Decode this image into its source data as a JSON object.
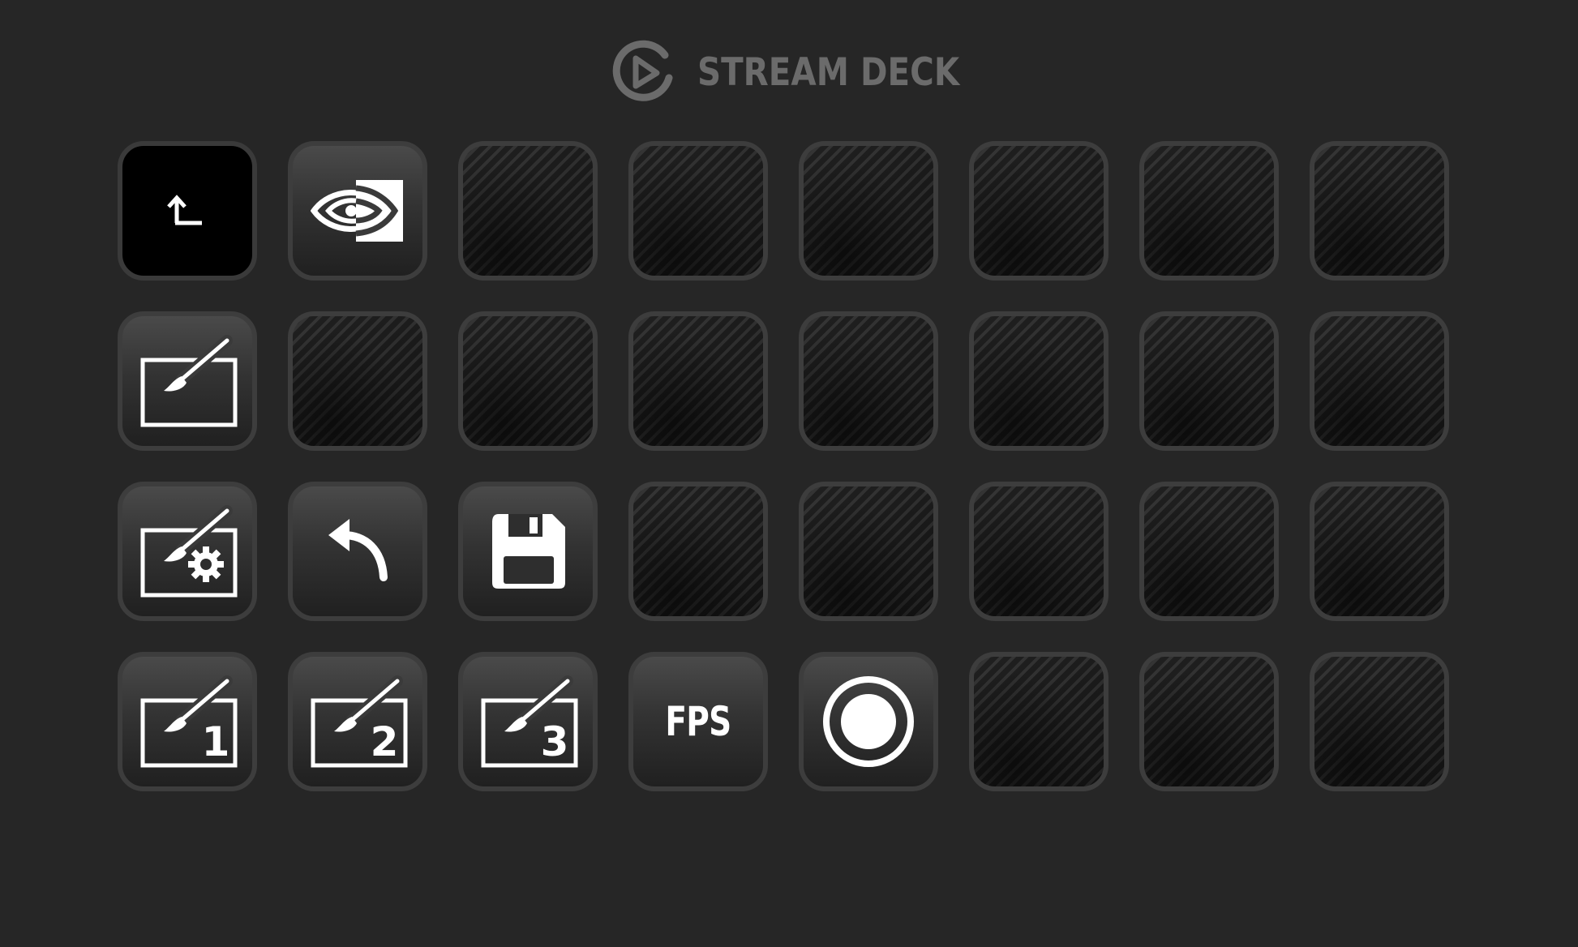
{
  "app": {
    "title": "STREAM DECK",
    "logo_icon": "elgato-logo-icon"
  },
  "keys": [
    {
      "row": 1,
      "col": 1,
      "type": "action",
      "icon": "back-arrow-icon",
      "label": ""
    },
    {
      "row": 1,
      "col": 2,
      "type": "action",
      "icon": "nvidia-logo-icon",
      "label": ""
    },
    {
      "row": 1,
      "col": 3,
      "type": "empty"
    },
    {
      "row": 1,
      "col": 4,
      "type": "empty"
    },
    {
      "row": 1,
      "col": 5,
      "type": "empty"
    },
    {
      "row": 1,
      "col": 6,
      "type": "empty"
    },
    {
      "row": 1,
      "col": 7,
      "type": "empty"
    },
    {
      "row": 1,
      "col": 8,
      "type": "empty"
    },
    {
      "row": 2,
      "col": 1,
      "type": "action",
      "icon": "photo-mode-icon",
      "label": ""
    },
    {
      "row": 2,
      "col": 2,
      "type": "empty"
    },
    {
      "row": 2,
      "col": 3,
      "type": "empty"
    },
    {
      "row": 2,
      "col": 4,
      "type": "empty"
    },
    {
      "row": 2,
      "col": 5,
      "type": "empty"
    },
    {
      "row": 2,
      "col": 6,
      "type": "empty"
    },
    {
      "row": 2,
      "col": 7,
      "type": "empty"
    },
    {
      "row": 2,
      "col": 8,
      "type": "empty"
    },
    {
      "row": 3,
      "col": 1,
      "type": "action",
      "icon": "photo-mode-settings-icon",
      "label": ""
    },
    {
      "row": 3,
      "col": 2,
      "type": "action",
      "icon": "undo-arrow-icon",
      "label": ""
    },
    {
      "row": 3,
      "col": 3,
      "type": "action",
      "icon": "save-floppy-icon",
      "label": ""
    },
    {
      "row": 3,
      "col": 4,
      "type": "empty"
    },
    {
      "row": 3,
      "col": 5,
      "type": "empty"
    },
    {
      "row": 3,
      "col": 6,
      "type": "empty"
    },
    {
      "row": 3,
      "col": 7,
      "type": "empty"
    },
    {
      "row": 3,
      "col": 8,
      "type": "empty"
    },
    {
      "row": 4,
      "col": 1,
      "type": "action",
      "icon": "photo-mode-1-icon",
      "label": "1"
    },
    {
      "row": 4,
      "col": 2,
      "type": "action",
      "icon": "photo-mode-2-icon",
      "label": "2"
    },
    {
      "row": 4,
      "col": 3,
      "type": "action",
      "icon": "photo-mode-3-icon",
      "label": "3"
    },
    {
      "row": 4,
      "col": 4,
      "type": "action",
      "icon": "fps-text-icon",
      "label": "FPS"
    },
    {
      "row": 4,
      "col": 5,
      "type": "action",
      "icon": "record-icon",
      "label": ""
    },
    {
      "row": 4,
      "col": 6,
      "type": "empty"
    },
    {
      "row": 4,
      "col": 7,
      "type": "empty"
    },
    {
      "row": 4,
      "col": 8,
      "type": "empty"
    }
  ]
}
